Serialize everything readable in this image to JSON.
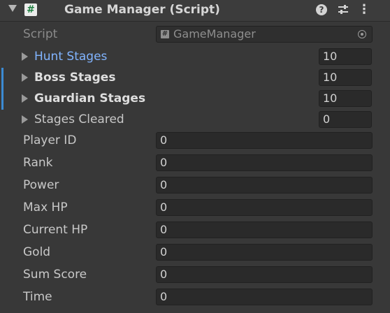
{
  "component": {
    "title": "Game Manager (Script)",
    "header_icons": [
      "foldout-arrow-icon",
      "script-icon",
      "help-icon",
      "presets-icon",
      "context-menu-icon"
    ]
  },
  "script_field": {
    "label": "Script",
    "value": "GameManager"
  },
  "stage_rows": [
    {
      "label": "Hunt Stages",
      "value": "10"
    },
    {
      "label": "Boss Stages",
      "value": "10"
    },
    {
      "label": "Guardian Stages",
      "value": "10"
    },
    {
      "label": "Stages Cleared",
      "value": "0"
    }
  ],
  "fields": [
    {
      "label": "Player ID",
      "value": "0"
    },
    {
      "label": "Rank",
      "value": "0"
    },
    {
      "label": "Power",
      "value": "0"
    },
    {
      "label": "Max HP",
      "value": "0"
    },
    {
      "label": "Current HP",
      "value": "0"
    },
    {
      "label": "Gold",
      "value": "0"
    },
    {
      "label": "Sum Score",
      "value": "0"
    },
    {
      "label": "Time",
      "value": "0"
    }
  ],
  "colors": {
    "link": "#81b4ff",
    "modified_bar": "#3c8bd4",
    "background": "#383838"
  }
}
